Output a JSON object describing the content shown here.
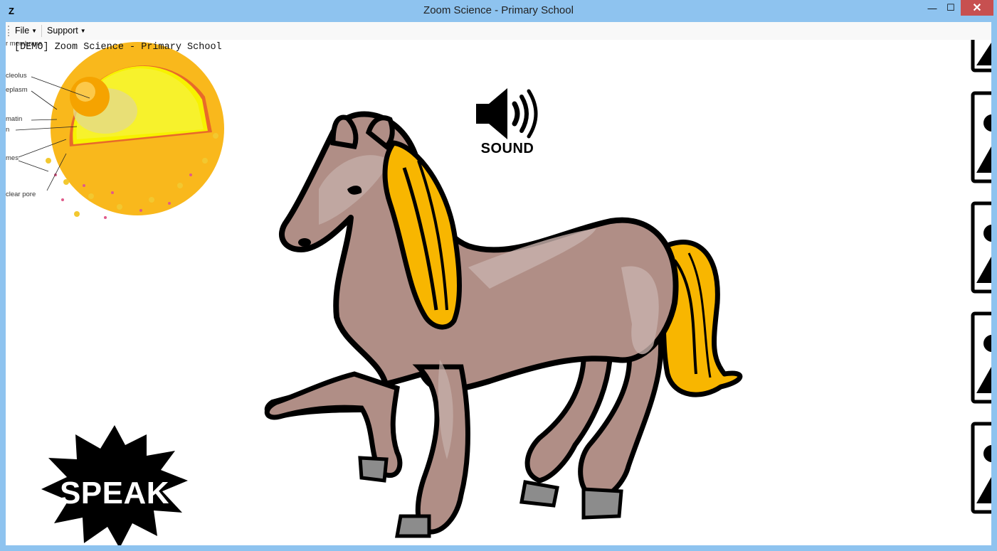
{
  "window": {
    "title": "Zoom Science - Primary School",
    "app_icon_glyph": "Z",
    "minimize_glyph": "—",
    "maximize_glyph": "☐",
    "close_glyph": "✕"
  },
  "menu": {
    "file_label": "File",
    "support_label": "Support"
  },
  "content": {
    "demo_label": "[DEMO] Zoom Science - Primary School",
    "cell_labels": [
      "r membrane",
      "cleolus",
      "eplasm",
      "matin",
      "n",
      "mes",
      "clear pore"
    ],
    "sound_label": "SOUND",
    "speak_label": "SPEAK"
  },
  "colors": {
    "titlebar": "#8ec3ef",
    "close_button": "#c75050",
    "horse_body": "#b08e86",
    "horse_mane": "#f8b600",
    "cell_outer": "#f9b81c",
    "cell_inner": "#f7f200"
  }
}
